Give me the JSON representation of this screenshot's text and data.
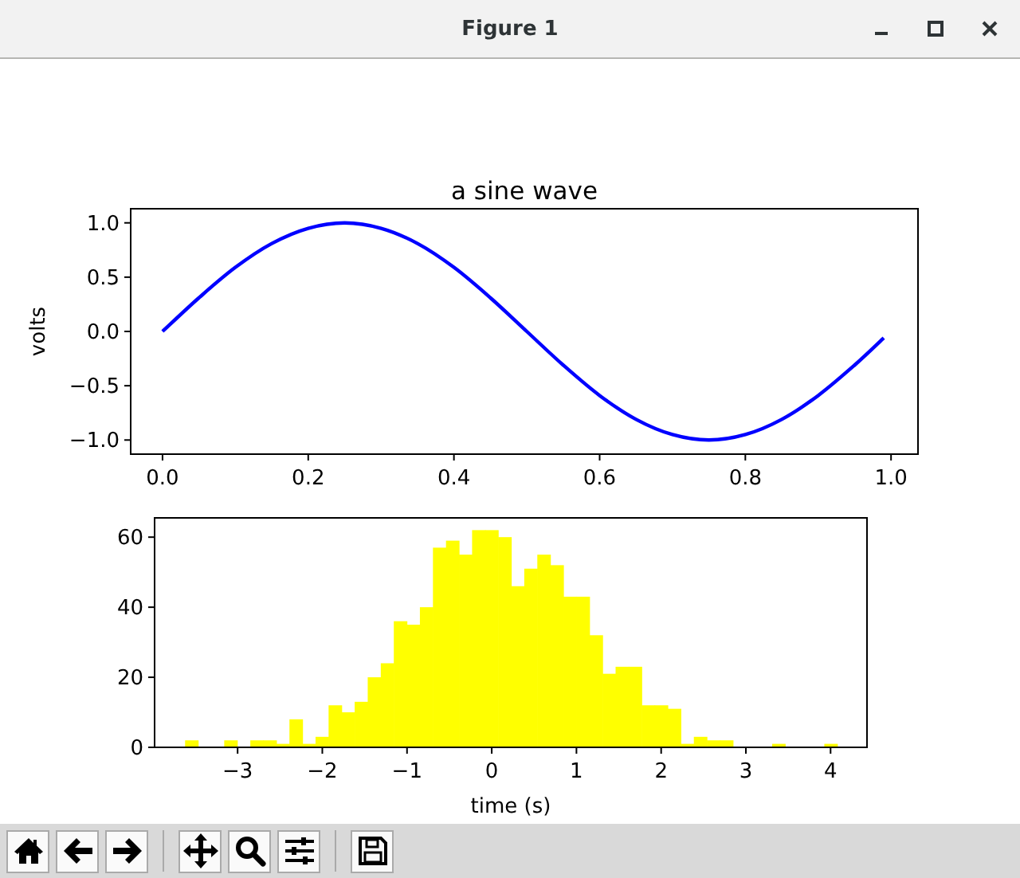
{
  "window": {
    "title": "Figure 1"
  },
  "figure": {
    "axes": [
      {
        "chart_data": {
          "type": "line",
          "title": "a sine wave",
          "ylabel": "volts",
          "xlim": [
            -0.0437,
            1.037
          ],
          "ylim": [
            -1.13,
            1.13
          ],
          "xticks": [
            {
              "value": 0,
              "label": "0.0"
            },
            {
              "value": 0.2,
              "label": "0.2"
            },
            {
              "value": 0.4,
              "label": "0.4"
            },
            {
              "value": 0.6,
              "label": "0.6"
            },
            {
              "value": 0.8,
              "label": "0.8"
            },
            {
              "value": 1,
              "label": "1.0"
            }
          ],
          "yticks": [
            {
              "value": 1,
              "label": "1.0"
            },
            {
              "value": 0.5,
              "label": "0.5"
            },
            {
              "value": 0,
              "label": "0.0"
            },
            {
              "value": -0.5,
              "label": "−0.5"
            },
            {
              "value": -1,
              "label": "−1.0"
            }
          ],
          "x": [
            0,
            0.05,
            0.1,
            0.15,
            0.2,
            0.25,
            0.3,
            0.35,
            0.4,
            0.45,
            0.5,
            0.55,
            0.6,
            0.65,
            0.7,
            0.75,
            0.8,
            0.85,
            0.9,
            0.95,
            0.99
          ],
          "series": [
            {
              "color": "#0000ff",
              "values": [
                0,
                0.31,
                0.59,
                0.81,
                0.95,
                1,
                0.95,
                0.81,
                0.59,
                0.31,
                0,
                -0.31,
                -0.59,
                -0.81,
                -0.95,
                -1,
                -0.95,
                -0.81,
                -0.59,
                -0.31,
                -0.06
              ]
            }
          ]
        }
      },
      {
        "chart_data": {
          "type": "bar",
          "xlabel": "time (s)",
          "xlim": [
            -3.98,
            4.43
          ],
          "ylim": [
            0,
            65.5
          ],
          "xticks": [
            {
              "value": -3,
              "label": "−3"
            },
            {
              "value": -2,
              "label": "−2"
            },
            {
              "value": -1,
              "label": "−1"
            },
            {
              "value": 0,
              "label": "0"
            },
            {
              "value": 1,
              "label": "1"
            },
            {
              "value": 2,
              "label": "2"
            },
            {
              "value": 3,
              "label": "3"
            },
            {
              "value": 4,
              "label": "4"
            }
          ],
          "yticks": [
            0,
            20,
            40,
            60
          ],
          "x": [
            -3.543,
            -3.389,
            -3.235,
            -3.081,
            -2.927,
            -2.773,
            -2.619,
            -2.465,
            -2.311,
            -2.157,
            -2.003,
            -1.849,
            -1.695,
            -1.541,
            -1.387,
            -1.233,
            -1.079,
            -0.925,
            -0.771,
            -0.617,
            -0.463,
            -0.309,
            -0.155,
            -0.001,
            0.153,
            0.307,
            0.461,
            0.615,
            0.769,
            0.923,
            1.077,
            1.231,
            1.385,
            1.539,
            1.693,
            1.847,
            2.001,
            2.155,
            2.309,
            2.463,
            2.617,
            2.771,
            2.925,
            3.079,
            3.233,
            3.387,
            3.541,
            3.695,
            3.849,
            4.003
          ],
          "series": [
            {
              "color": "#ffff00",
              "values": [
                2,
                0,
                0,
                2,
                0,
                2,
                2,
                1,
                8,
                1,
                3,
                12,
                10,
                13,
                20,
                24,
                36,
                35,
                40,
                57,
                59,
                55,
                62,
                62,
                60,
                46,
                51,
                55,
                52,
                43,
                43,
                32,
                21,
                23,
                23,
                12,
                12,
                11,
                1,
                3,
                2,
                2,
                0,
                0,
                0,
                1,
                0,
                0,
                0,
                1
              ]
            }
          ]
        }
      }
    ]
  },
  "toolbar": [
    {
      "kind": "home"
    },
    {
      "kind": "back"
    },
    {
      "kind": "forward"
    },
    {
      "kind": "separator"
    },
    {
      "kind": "pan"
    },
    {
      "kind": "zoom"
    },
    {
      "kind": "configure"
    },
    {
      "kind": "separator"
    },
    {
      "kind": "save"
    }
  ]
}
